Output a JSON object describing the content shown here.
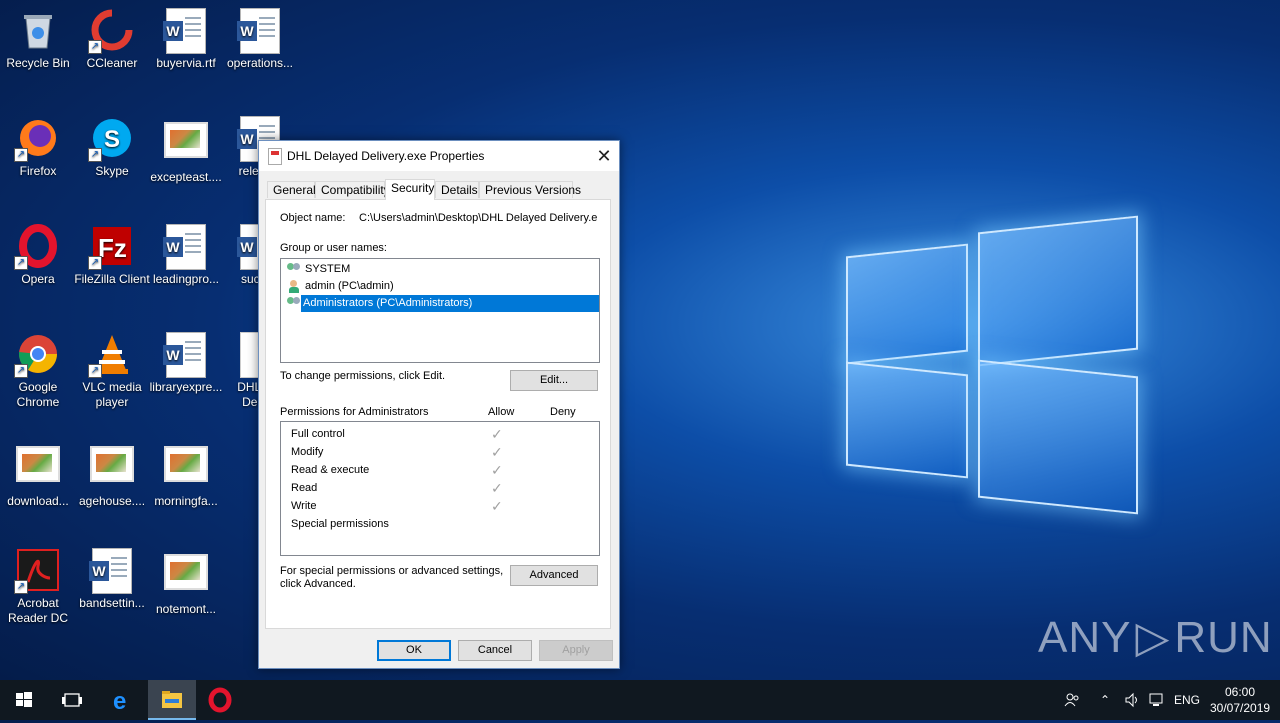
{
  "desktop_icons": [
    {
      "label": "Recycle Bin"
    },
    {
      "label": "CCleaner"
    },
    {
      "label": "buyervia.rtf"
    },
    {
      "label": "operations..."
    },
    {
      "label": "Firefox"
    },
    {
      "label": "Skype"
    },
    {
      "label": "excepteast...."
    },
    {
      "label": "releas..."
    },
    {
      "label": "Opera"
    },
    {
      "label": "FileZilla Client"
    },
    {
      "label": "leadingpro..."
    },
    {
      "label": "suchi..."
    },
    {
      "label": "Google Chrome"
    },
    {
      "label": "VLC media player"
    },
    {
      "label": "libraryexpre..."
    },
    {
      "label": "DHL D... Deliv..."
    },
    {
      "label": "download..."
    },
    {
      "label": "agehouse...."
    },
    {
      "label": "morningfa..."
    },
    {
      "label": "Acrobat Reader DC"
    },
    {
      "label": "bandsettin..."
    },
    {
      "label": "notemont..."
    }
  ],
  "dialog": {
    "title": "DHL Delayed Delivery.exe Properties",
    "tabs": [
      "General",
      "Compatibility",
      "Security",
      "Details",
      "Previous Versions"
    ],
    "active_tab": "Security",
    "object_name_label": "Object name:",
    "object_name_value": "C:\\Users\\admin\\Desktop\\DHL Delayed Delivery.e",
    "group_label": "Group or user names:",
    "users": [
      {
        "name": "SYSTEM",
        "icon": "group-icon"
      },
      {
        "name": "admin (PC\\admin)",
        "icon": "user-icon"
      },
      {
        "name": "Administrators (PC\\Administrators)",
        "icon": "group-icon",
        "selected": true
      }
    ],
    "change_text": "To change permissions, click Edit.",
    "edit_button": "Edit...",
    "permissions_label": "Permissions for Administrators",
    "allow_header": "Allow",
    "deny_header": "Deny",
    "permissions": [
      {
        "name": "Full control",
        "allow": true,
        "deny": false
      },
      {
        "name": "Modify",
        "allow": true,
        "deny": false
      },
      {
        "name": "Read & execute",
        "allow": true,
        "deny": false
      },
      {
        "name": "Read",
        "allow": true,
        "deny": false
      },
      {
        "name": "Write",
        "allow": true,
        "deny": false
      },
      {
        "name": "Special permissions",
        "allow": false,
        "deny": false
      }
    ],
    "advanced_text_1": "For special permissions or advanced settings,",
    "advanced_text_2": "click Advanced.",
    "advanced_button": "Advanced",
    "ok_button": "OK",
    "cancel_button": "Cancel",
    "apply_button": "Apply",
    "check_glyph": "✓",
    "close_glyph": "✕"
  },
  "taskbar": {
    "language": "ENG",
    "time": "06:00",
    "date": "30/07/2019"
  },
  "watermark": {
    "left": "ANY",
    "right": "RUN"
  },
  "colors": {
    "selection": "#0078d7",
    "taskbar": "#101820"
  }
}
